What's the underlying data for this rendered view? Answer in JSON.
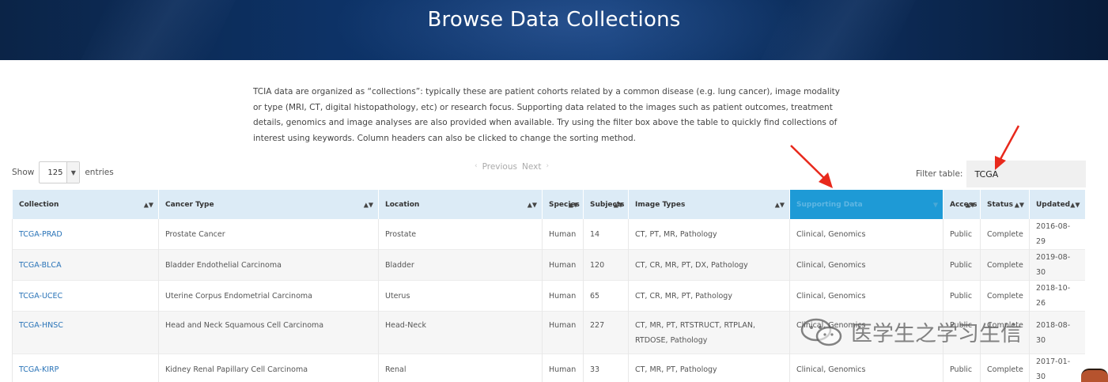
{
  "banner": {
    "title": "Browse Data Collections"
  },
  "intro": {
    "text": "TCIA data are organized as “collections”: typically these are patient cohorts related by a common disease (e.g. lung cancer), image modality or type (MRI, CT, digital histopathology, etc) or research focus. Supporting data related to the images such as patient outcomes, treatment details, genomics and image analyses are also provided when available. Try using the filter box above the table to quickly find collections of interest using keywords. Column headers can also be clicked to change the sorting method."
  },
  "controls": {
    "show_label": "Show",
    "length_value": "125",
    "entries_label": "entries",
    "previous_label": "Previous",
    "next_label": "Next",
    "filter_label": "Filter table:",
    "filter_value": "TCGA"
  },
  "table": {
    "columns": [
      "Collection",
      "Cancer Type",
      "Location",
      "Species",
      "Subjects",
      "Image Types",
      "Supporting Data",
      "Access",
      "Status",
      "Updated"
    ],
    "active_column": "Supporting Data",
    "rows": [
      [
        "TCGA-PRAD",
        "Prostate Cancer",
        "Prostate",
        "Human",
        "14",
        "CT, PT, MR, Pathology",
        "Clinical, Genomics",
        "Public",
        "Complete",
        "2016-08-29"
      ],
      [
        "TCGA-BLCA",
        "Bladder Endothelial Carcinoma",
        "Bladder",
        "Human",
        "120",
        "CT, CR, MR, PT, DX, Pathology",
        "Clinical, Genomics",
        "Public",
        "Complete",
        "2019-08-30"
      ],
      [
        "TCGA-UCEC",
        "Uterine Corpus Endometrial Carcinoma",
        "Uterus",
        "Human",
        "65",
        "CT, CR, MR, PT, Pathology",
        "Clinical, Genomics",
        "Public",
        "Complete",
        "2018-10-26"
      ],
      [
        "TCGA-HNSC",
        "Head and Neck Squamous Cell Carcinoma",
        "Head-Neck",
        "Human",
        "227",
        "CT, MR, PT, RTSTRUCT, RTPLAN, RTDOSE, Pathology",
        "Clinical, Genomics",
        "Public",
        "Complete",
        "2018-08-30"
      ],
      [
        "TCGA-KIRP",
        "Kidney Renal Papillary Cell Carcinoma",
        "Renal",
        "Human",
        "33",
        "CT, MR, PT, Pathology",
        "Clinical, Genomics",
        "Public",
        "Complete",
        "2017-01-30"
      ]
    ]
  },
  "watermark": {
    "text": "医学生之学习生信",
    "icon": "wechat-icon"
  },
  "colors": {
    "banner": "#0d3266",
    "header": "#dcebf6",
    "active_header": "#1e9ad6",
    "link": "#2a74b8",
    "annotation_arrow": "#e8291c"
  }
}
